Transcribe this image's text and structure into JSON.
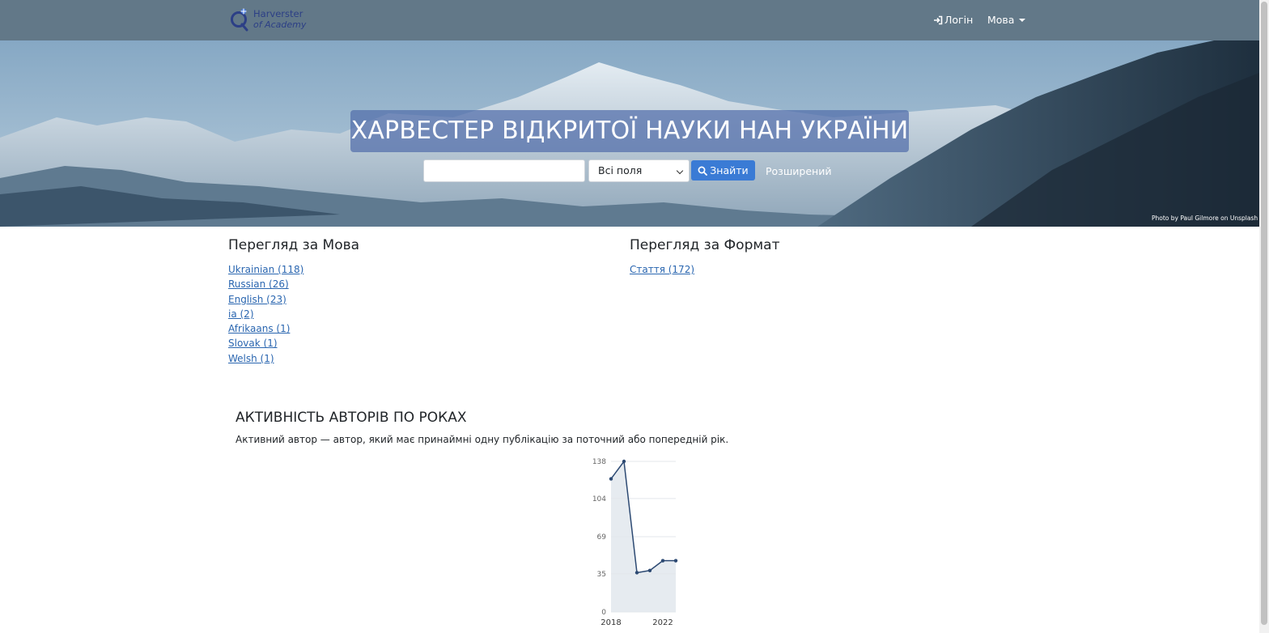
{
  "nav": {
    "logo_line1": "Harverster",
    "logo_line2": "of Academy",
    "login": "Логін",
    "language": "Мова"
  },
  "hero": {
    "title": "ХАРВЕСТЕР ВІДКРИТОЇ НАУКИ НАН УКРАЇНИ",
    "search_value": "",
    "search_scope": "Всі поля",
    "search_button": "Знайти",
    "advanced": "Розширений",
    "photo_credit": "Photo by Paul Gilmore on Unsplash"
  },
  "facets": {
    "language": {
      "title": "Перегляд за Мова",
      "items": [
        "Ukrainian (118)",
        "Russian (26)",
        "English (23)",
        "ia (2)",
        "Afrikaans (1)",
        "Slovak (1)",
        "Welsh (1)"
      ]
    },
    "format": {
      "title": "Перегляд за Формат",
      "items": [
        "Стаття (172)"
      ]
    }
  },
  "activity": {
    "title": "АКТИВНІСТЬ АВТОРІВ ПО РОКАХ",
    "description": "Активний автор — автор, який має принаймні одну публікацію за поточний або попередній рік."
  },
  "chart_data": {
    "type": "area",
    "title": "",
    "xlabel": "",
    "ylabel": "",
    "x": [
      2018,
      2019,
      2020,
      2021,
      2022,
      2023
    ],
    "values": [
      122,
      138,
      36,
      38,
      47,
      47
    ],
    "xticks": [
      "2018",
      "2022"
    ],
    "yticks": [
      "0",
      "35",
      "69",
      "104",
      "138"
    ],
    "ylim": [
      0,
      138
    ],
    "grid": true,
    "line_color": "#2d4a73",
    "fill_color": "#e6ebf0"
  }
}
